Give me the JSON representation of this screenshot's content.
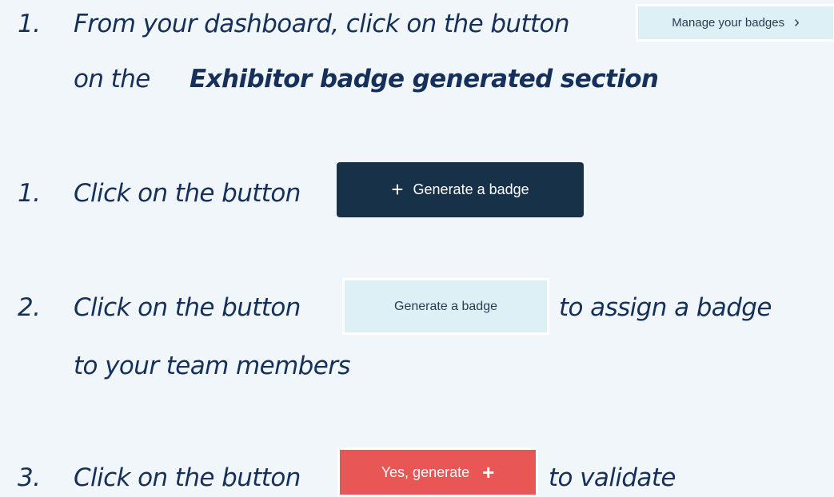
{
  "steps": [
    {
      "number": "1.",
      "text_before": "From your dashboard, click on the button",
      "button_label": "Manage your badges",
      "button_icon": "chevron-right-icon",
      "text_line2_prefix": "on the ",
      "text_line2_bold": "Exhibitor badge generated section"
    },
    {
      "number": "1.",
      "text_before": "Click on the button",
      "button_label": "Generate a badge",
      "button_icon": "plus-icon"
    },
    {
      "number": "2.",
      "text_before": "Click on the button",
      "button_label": "Generate a badge",
      "text_after": "to assign a badge",
      "text_line2": "to your team members"
    },
    {
      "number": "3.",
      "text_before": "Click on the button",
      "button_label": "Yes, generate",
      "button_icon": "plus-icon",
      "text_after": "to validate"
    }
  ],
  "icons": {
    "chevron": "›",
    "plus": "+"
  },
  "colors": {
    "background": "#f0f6fa",
    "text": "#15305a",
    "light_button": "#dcf0f5",
    "dark_button": "#173149",
    "red_button": "#e85656"
  }
}
